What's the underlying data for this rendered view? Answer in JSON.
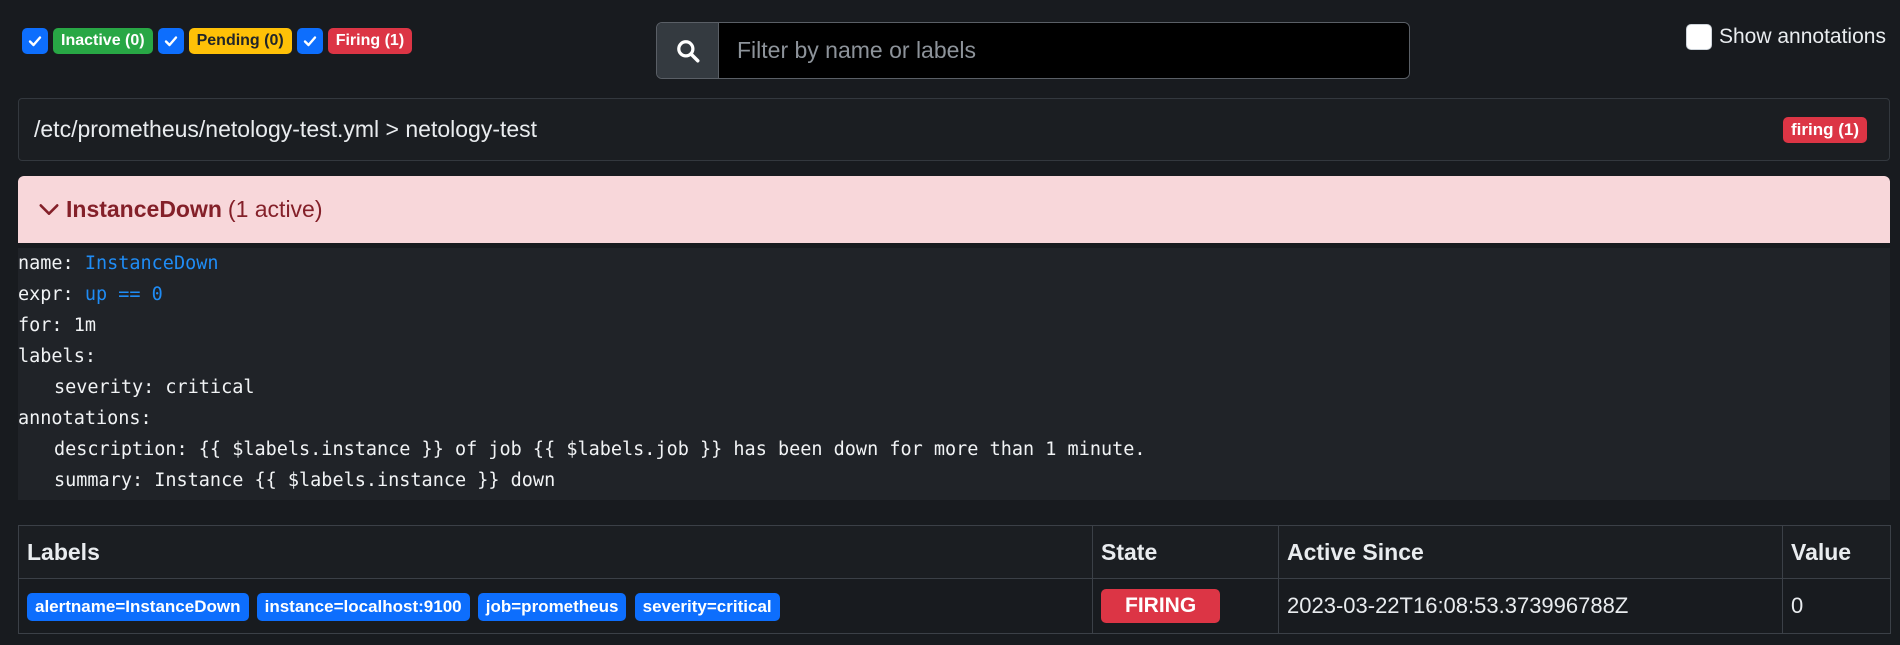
{
  "filters": [
    {
      "label": "Inactive (0)",
      "checked": true,
      "color": "#28a745"
    },
    {
      "label": "Pending (0)",
      "checked": true,
      "color": "#ffc107"
    },
    {
      "label": "Firing (1)",
      "checked": true,
      "color": "#dc3545"
    }
  ],
  "search": {
    "placeholder": "Filter by name or labels",
    "value": "",
    "icon": "search-icon"
  },
  "show_annotations": {
    "label": "Show annotations",
    "checked": false
  },
  "group": {
    "title": "/etc/prometheus/netology-test.yml > netology-test",
    "badge": "firing (1)"
  },
  "rule": {
    "name": "InstanceDown",
    "count": "(1 active)",
    "code": {
      "name_key": "name:",
      "name_val": "InstanceDown",
      "expr_key": "expr:",
      "expr_val": "up == 0",
      "for_key": "for:",
      "for_val": "1m",
      "labels_key": "labels:",
      "severity_line": "severity: critical",
      "annotations_key": "annotations:",
      "description_line": "description: {{ $labels.instance }} of job {{ $labels.job }} has been down for more than 1 minute.",
      "summary_line": "summary: Instance {{ $labels.instance }} down"
    }
  },
  "table": {
    "headers": {
      "labels": "Labels",
      "state": "State",
      "active_since": "Active Since",
      "value": "Value"
    },
    "rows": [
      {
        "labels": [
          "alertname=InstanceDown",
          "instance=localhost:9100",
          "job=prometheus",
          "severity=critical"
        ],
        "state": "FIRING",
        "active_since": "2023-03-22T16:08:53.373996788Z",
        "value": "0"
      }
    ]
  },
  "colors": {
    "background": "#181b1f",
    "primary": "#0d6efd",
    "danger": "#dc3545",
    "success": "#28a745",
    "warning": "#ffc107",
    "alert_bg": "#f8d7da",
    "alert_text": "#842029"
  }
}
